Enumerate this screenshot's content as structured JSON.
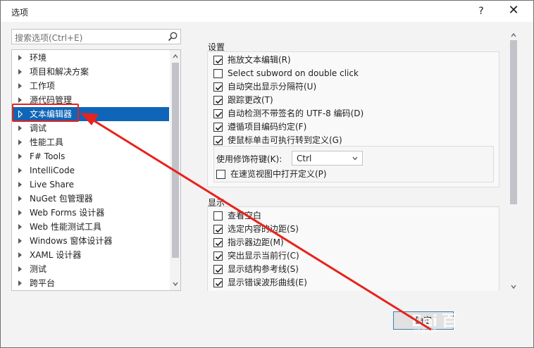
{
  "window": {
    "title": "选项",
    "help_label": "?",
    "close_label": "✕"
  },
  "search": {
    "placeholder": "搜索选项(Ctrl+E)"
  },
  "tree": {
    "items": [
      {
        "label": "环境"
      },
      {
        "label": "项目和解决方案"
      },
      {
        "label": "工作项"
      },
      {
        "label": "源代码管理"
      },
      {
        "label": "文本编辑器",
        "selected": true
      },
      {
        "label": "调试"
      },
      {
        "label": "性能工具"
      },
      {
        "label": "F# Tools"
      },
      {
        "label": "IntelliCode"
      },
      {
        "label": "Live Share"
      },
      {
        "label": "NuGet 包管理器"
      },
      {
        "label": "Web Forms 设计器"
      },
      {
        "label": "Web 性能测试工具"
      },
      {
        "label": "Windows 窗体设计器"
      },
      {
        "label": "XAML 设计器"
      },
      {
        "label": "测试"
      },
      {
        "label": "跨平台"
      }
    ]
  },
  "settings": {
    "title": "设置",
    "options": [
      {
        "label": "拖放文本编辑(R)",
        "checked": true
      },
      {
        "label": "Select subword on double click",
        "checked": false
      },
      {
        "label": "自动突出显示分隔符(U)",
        "checked": true
      },
      {
        "label": "跟踪更改(T)",
        "checked": true
      },
      {
        "label": "自动检测不带签名的 UTF-8 编码(D)",
        "checked": true
      },
      {
        "label": "遵循项目编码约定(F)",
        "checked": true
      },
      {
        "label": "使鼠标单击可执行转到定义(G)",
        "checked": true
      }
    ],
    "modifier_label": "使用修饰符键(K):",
    "modifier_value": "Ctrl",
    "peek_label": "在速览视图中打开定义(P)",
    "peek_checked": false
  },
  "display": {
    "title": "显示",
    "options": [
      {
        "label": "查看空白",
        "checked": false
      },
      {
        "label": "选定内容的边距(S)",
        "checked": true
      },
      {
        "label": "指示器边距(M)",
        "checked": true
      },
      {
        "label": "突出显示当前行(C)",
        "checked": true
      },
      {
        "label": "显示结构参考线(S)",
        "checked": true
      },
      {
        "label": "显示错误波形曲线(E)",
        "checked": true
      }
    ]
  },
  "footer": {
    "ok_label": "确定"
  },
  "watermark": {
    "text": "Bai 百",
    "sub": "jingyan"
  },
  "colors": {
    "selection": "#0f65b8",
    "annotation": "#e8221c",
    "accent": "#3c7fb1"
  }
}
